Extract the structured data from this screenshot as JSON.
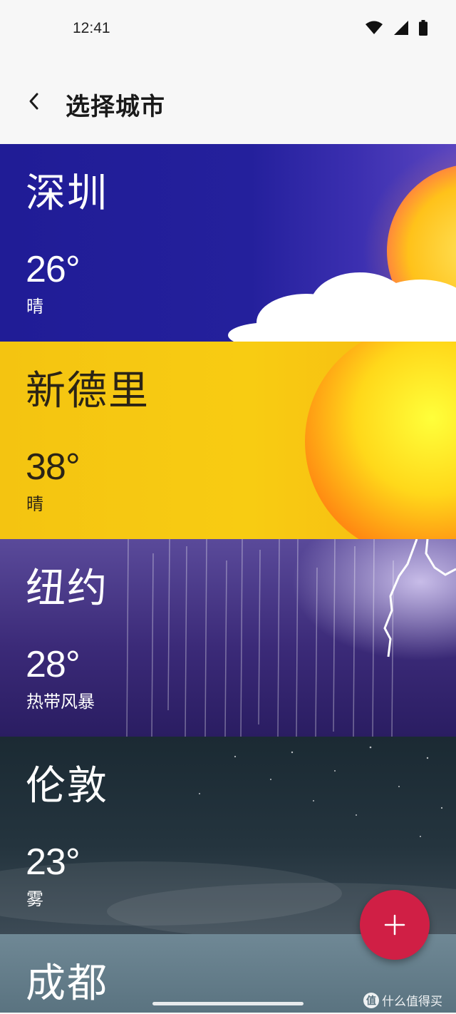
{
  "status_bar": {
    "time": "12:41",
    "icons": [
      "wifi-icon",
      "signal-icon",
      "battery-icon"
    ]
  },
  "header": {
    "back_icon": "chevron-left-icon",
    "title": "选择城市"
  },
  "cities": [
    {
      "name": "深圳",
      "temperature": "26°",
      "condition": "晴",
      "theme": "sunny-cloud",
      "bg": "#201c96"
    },
    {
      "name": "新德里",
      "temperature": "38°",
      "condition": "晴",
      "theme": "sunny-hot",
      "bg": "#f6c412"
    },
    {
      "name": "纽约",
      "temperature": "28°",
      "condition": "热带风暴",
      "theme": "storm",
      "bg": "#3b2a78"
    },
    {
      "name": "伦敦",
      "temperature": "23°",
      "condition": "雾",
      "theme": "fog-night",
      "bg": "#24343e"
    },
    {
      "name": "成都",
      "temperature": "",
      "condition": "",
      "theme": "overcast",
      "bg": "#6f8895"
    }
  ],
  "fab": {
    "icon": "plus-icon",
    "color": "#d01f45"
  },
  "watermark": {
    "badge": "值",
    "text": "什么值得买"
  }
}
